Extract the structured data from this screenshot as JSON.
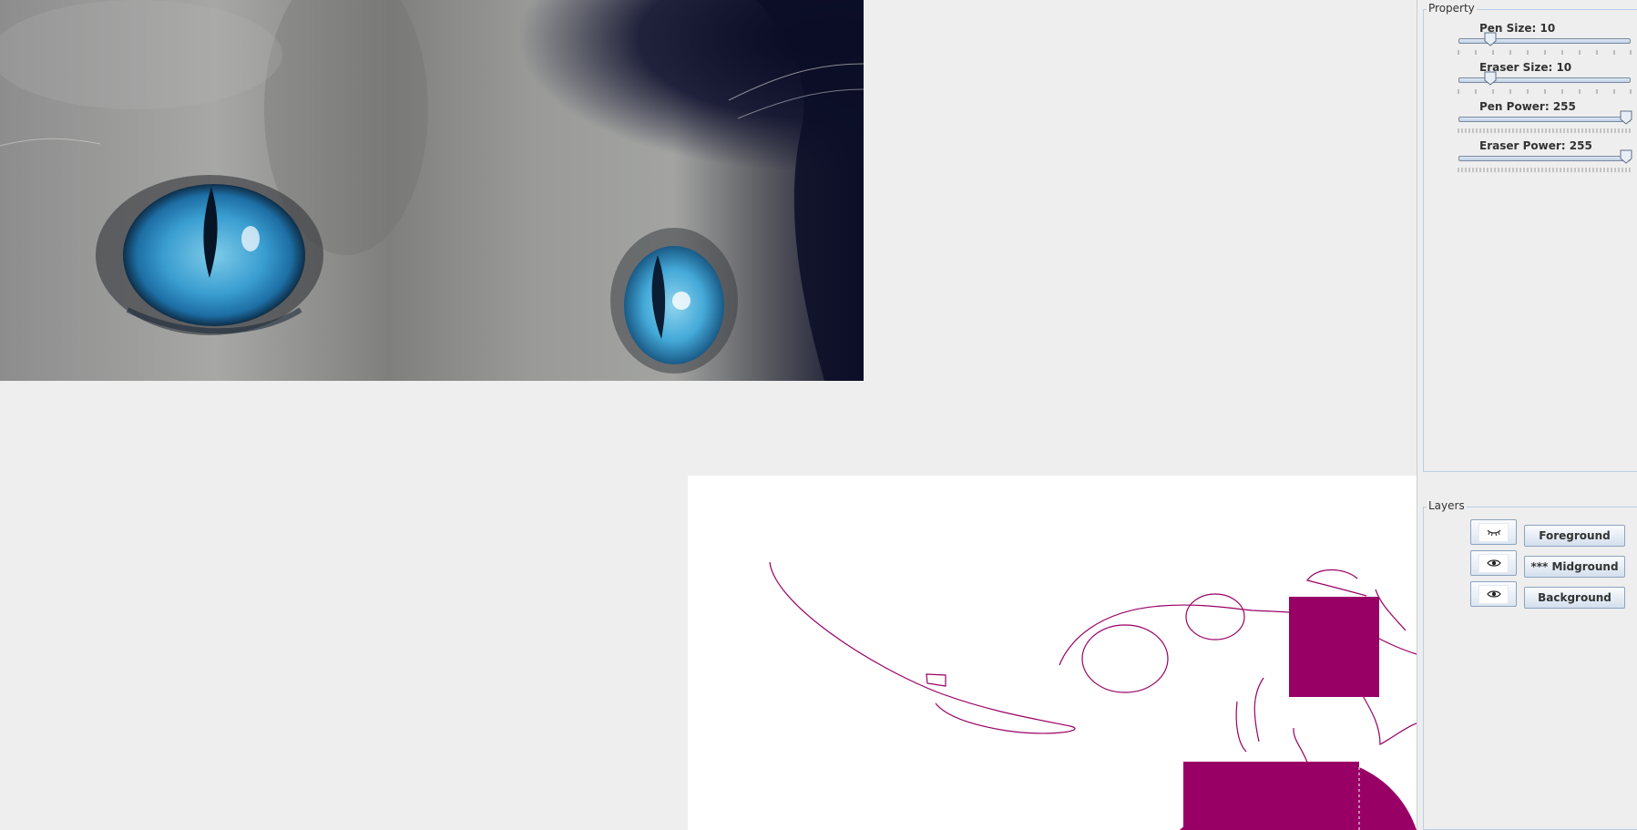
{
  "property_panel": {
    "title": "Property",
    "sliders": [
      {
        "label": "Pen Size: 10",
        "value": 10,
        "min": 0,
        "max": 100
      },
      {
        "label": "Eraser Size: 10",
        "value": 10,
        "min": 0,
        "max": 100
      },
      {
        "label": "Pen Power: 255",
        "value": 255,
        "min": 0,
        "max": 255
      },
      {
        "label": "Eraser Power: 255",
        "value": 255,
        "min": 0,
        "max": 255
      }
    ]
  },
  "layers_panel": {
    "title": "Layers",
    "layers": [
      {
        "name": "Foreground",
        "visible": false,
        "eye_icon": "eye-closed-icon"
      },
      {
        "name": "*** Midground",
        "visible": true,
        "eye_icon": "eye-icon"
      },
      {
        "name": "Background",
        "visible": true,
        "eye_icon": "eye-icon"
      }
    ]
  },
  "colors": {
    "stroke": "#990066",
    "panel_bg": "#eeeeee",
    "canvas_bg": "#ffffff"
  }
}
